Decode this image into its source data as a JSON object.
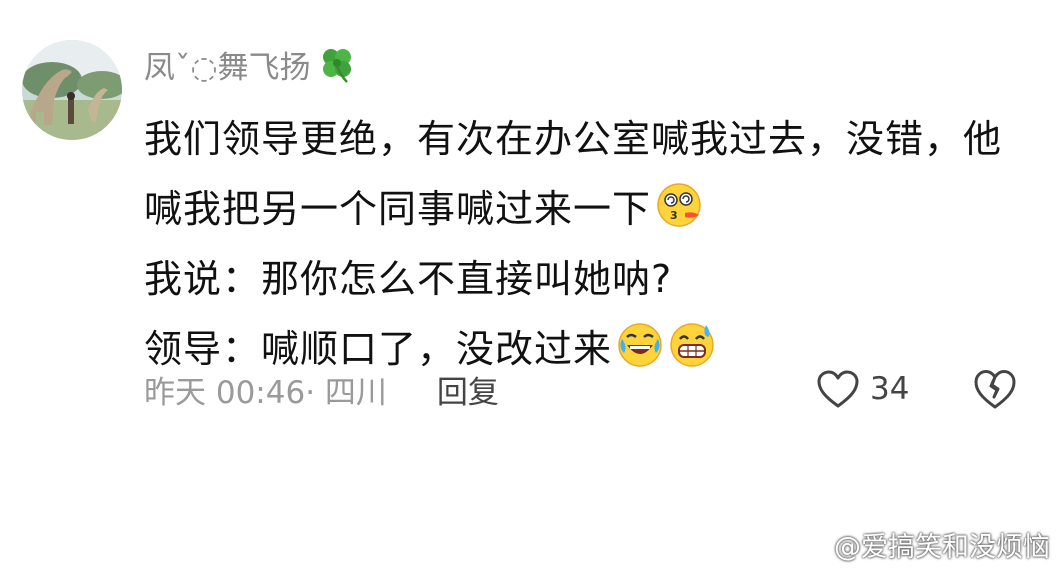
{
  "comment": {
    "username": "凤ˇ◌舞飞扬",
    "username_icon": "four-leaf-clover",
    "lines": [
      "我们领导更绝，有次在办公室喊我过去，没错，他",
      "喊我把另一个同事喊过来一下",
      "我说：那你怎么不直接叫她呐?",
      "领导：喊顺口了，没改过来"
    ],
    "emojis": {
      "line2": "dizzy-face",
      "line4_a": "rolling-laughing-face",
      "line4_b": "grinning-sweat-face"
    },
    "timestamp": "昨天 00:46",
    "location": "· 四川",
    "reply_label": "回复",
    "like_count": "34",
    "like_icon": "heart-outline",
    "dislike_icon": "broken-heart-outline"
  },
  "watermark": {
    "text": "@爱搞笑和没烦恼",
    "icon": "weibo-logo"
  },
  "colors": {
    "username": "#8a8a8a",
    "body": "#111111",
    "meta": "#9a9a9a",
    "action": "#444444"
  }
}
